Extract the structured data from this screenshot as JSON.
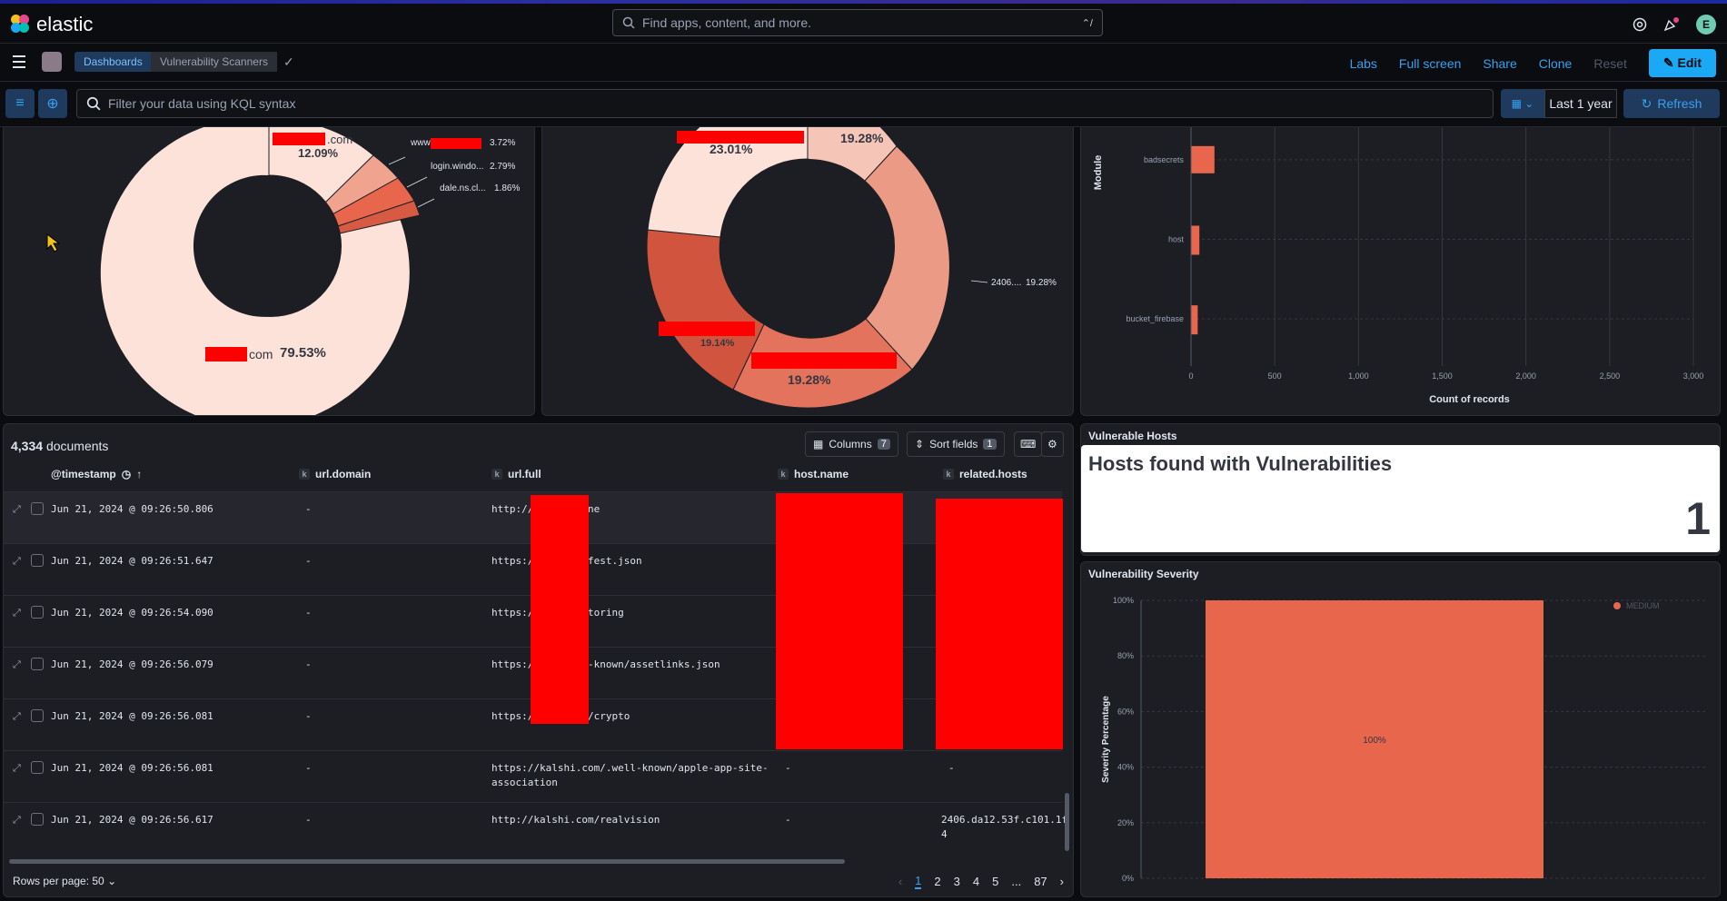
{
  "app": {
    "logo_text": "elastic",
    "search_placeholder": "Find apps, content, and more.",
    "search_shortcut": "⌃/",
    "user_initial": "E"
  },
  "breadcrumb": {
    "items": [
      "Dashboards",
      "Vulnerability Scanners"
    ]
  },
  "toolbar": {
    "labs": "Labs",
    "fullscreen": "Full screen",
    "share": "Share",
    "clone": "Clone",
    "reset": "Reset",
    "edit": "Edit"
  },
  "query": {
    "placeholder": "Filter your data using KQL syntax",
    "date_range": "Last 1 year",
    "refresh": "Refresh"
  },
  "donut1": {
    "labels": [
      {
        "text": ".com",
        "pct": "12.09%"
      },
      {
        "text": "www",
        "pct": "3.72%"
      },
      {
        "text": "login.windo...",
        "pct": "2.79%"
      },
      {
        "text": "dale.ns.cl...",
        "pct": "1.86%"
      },
      {
        "text": "com",
        "pct": "79.53%"
      }
    ]
  },
  "donut2": {
    "labels": [
      {
        "text": "",
        "pct": "23.01%"
      },
      {
        "text": "",
        "pct": "19.28%"
      },
      {
        "text": "2406....",
        "pct": "19.28%"
      },
      {
        "text": "",
        "pct": "19.14%"
      },
      {
        "text": "",
        "pct": "19.28%"
      }
    ]
  },
  "chart_data": [
    {
      "type": "bar",
      "title": "",
      "orientation": "horizontal",
      "categories": [
        "badsecrets",
        "host",
        "bucket_firebase"
      ],
      "values": [
        140,
        50,
        40
      ],
      "xlabel": "Count of records",
      "ylabel": "Module",
      "xlim": [
        0,
        3000
      ],
      "xticks": [
        "0",
        "500",
        "1,000",
        "1,500",
        "2,000",
        "2,500",
        "3,000"
      ],
      "color": "#e7664c"
    },
    {
      "type": "bar",
      "title": "Vulnerability Severity",
      "categories": [
        "MEDIUM"
      ],
      "values": [
        100
      ],
      "ylabel": "Severity Percentage",
      "ylim": [
        0,
        100
      ],
      "yticks": [
        "0%",
        "20%",
        "40%",
        "60%",
        "80%",
        "100%"
      ],
      "data_label": "100%",
      "legend": [
        "MEDIUM"
      ],
      "color": "#e7664c"
    }
  ],
  "table": {
    "doc_count": "4,334",
    "doc_label": "documents",
    "columns_btn": "Columns",
    "columns_count": "7",
    "sort_btn": "Sort fields",
    "sort_count": "1",
    "headers": [
      "@timestamp",
      "url.domain",
      "url.full",
      "host.name",
      "related.hosts"
    ],
    "rows": [
      {
        "ts": "Jun 21, 2024 @ 09:26:50.806",
        "domain": "-",
        "url": "http://          n/aimstone",
        "host": "",
        "related": ""
      },
      {
        "ts": "Jun 21, 2024 @ 09:26:51.647",
        "domain": "-",
        "url": "https://         om/manifest.json",
        "host": "",
        "related": ""
      },
      {
        "ts": "Jun 21, 2024 @ 09:26:54.090",
        "domain": "-",
        "url": "https://         om/monitoring",
        "host": "",
        "related": ""
      },
      {
        "ts": "Jun 21, 2024 @ 09:26:56.079",
        "domain": "-",
        "url": "https://         m/.well-known/assetlinks.json",
        "host": "",
        "related": ""
      },
      {
        "ts": "Jun 21, 2024 @ 09:26:56.081",
        "domain": "-",
        "url": "https://         om/live/crypto",
        "host": "",
        "related": ""
      },
      {
        "ts": "Jun 21, 2024 @ 09:26:56.081",
        "domain": "-",
        "url": "https://kalshi.com/.well-known/apple-app-site-",
        "url2": "association",
        "host": "-",
        "related": "-"
      },
      {
        "ts": "Jun 21, 2024 @ 09:26:56.617",
        "domain": "-",
        "url": "http://kalshi.com/realvision",
        "host": "-",
        "related": "2406.da12.53f.c101.1f",
        "related2": "4"
      }
    ],
    "rows_per_page": "Rows per page: 50",
    "pages": [
      "1",
      "2",
      "3",
      "4",
      "5",
      "...",
      "87"
    ]
  },
  "vuln_hosts": {
    "panel_title": "Vulnerable Hosts",
    "metric_title": "Hosts found with Vulnerabilities",
    "metric_value": "1"
  },
  "severity": {
    "panel_title": "Vulnerability Severity"
  }
}
